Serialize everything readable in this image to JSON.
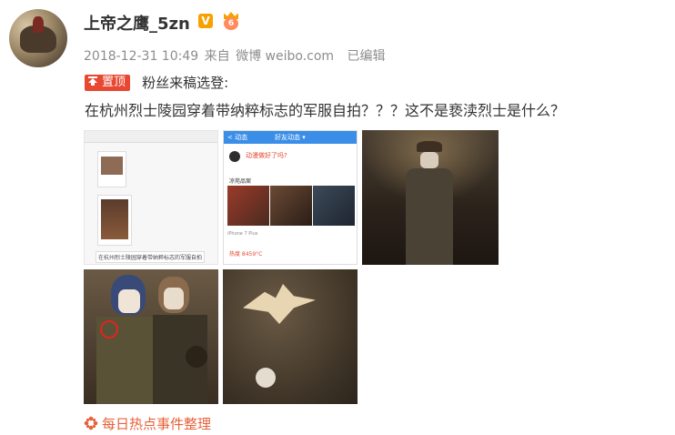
{
  "user": {
    "name": "上帝之鹰_5zn",
    "verified_mark": "V",
    "level_mark": "6"
  },
  "meta": {
    "timestamp": "2018-12-31 10:49",
    "source_prefix": "来自",
    "source": "微博 weibo.com",
    "edited": "已编辑"
  },
  "pin": {
    "label": "置顶",
    "text": "粉丝来稿选登:"
  },
  "post": {
    "body": "在杭州烈士陵园穿着带纳粹标志的军服自拍？？？这不是亵渎烈士是什么？"
  },
  "images": {
    "img1_caption": "在杭州烈士陵园穿着带纳粹标志的军服自拍",
    "img2_tab_left": "< 动态",
    "img2_tab_center": "好友动态 ▾",
    "img2_red_text": "动漫做好了吗?",
    "img2_sub_text": "凉苑品案",
    "img2_footer": "iPhone 7 Plus",
    "img2_hot": "热度 8459°C"
  },
  "footer": {
    "topic": "每日热点事件整理"
  },
  "colors": {
    "accent": "#e84732",
    "footer": "#e8613a",
    "meta": "#8d8d8d",
    "text": "#333333"
  }
}
